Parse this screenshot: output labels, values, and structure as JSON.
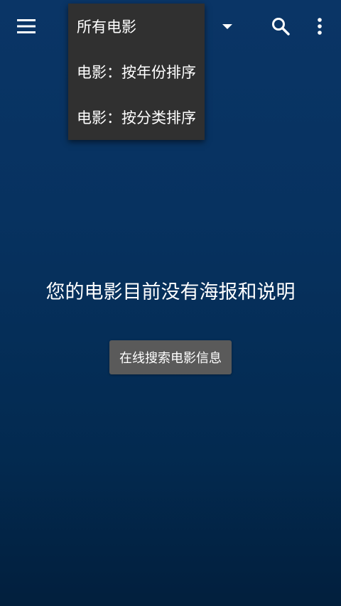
{
  "toolbar": {
    "menu_icon": "hamburger-menu-icon",
    "dropdown_arrow_icon": "arrow-drop-down-icon",
    "search_icon": "search-icon",
    "more_icon": "more-vertical-icon"
  },
  "dropdown": {
    "items": [
      {
        "label": "所有电影"
      },
      {
        "label": "电影：按年份排序"
      },
      {
        "label": "电影：按分类排序"
      }
    ]
  },
  "main": {
    "empty_message": "您的电影目前没有海报和说明",
    "search_button_label": "在线搜索电影信息"
  },
  "colors": {
    "background_top": "#0a3566",
    "background_bottom": "#021f3d",
    "menu_background": "#303030",
    "button_background": "#5a5a5a",
    "text": "#ffffff"
  }
}
